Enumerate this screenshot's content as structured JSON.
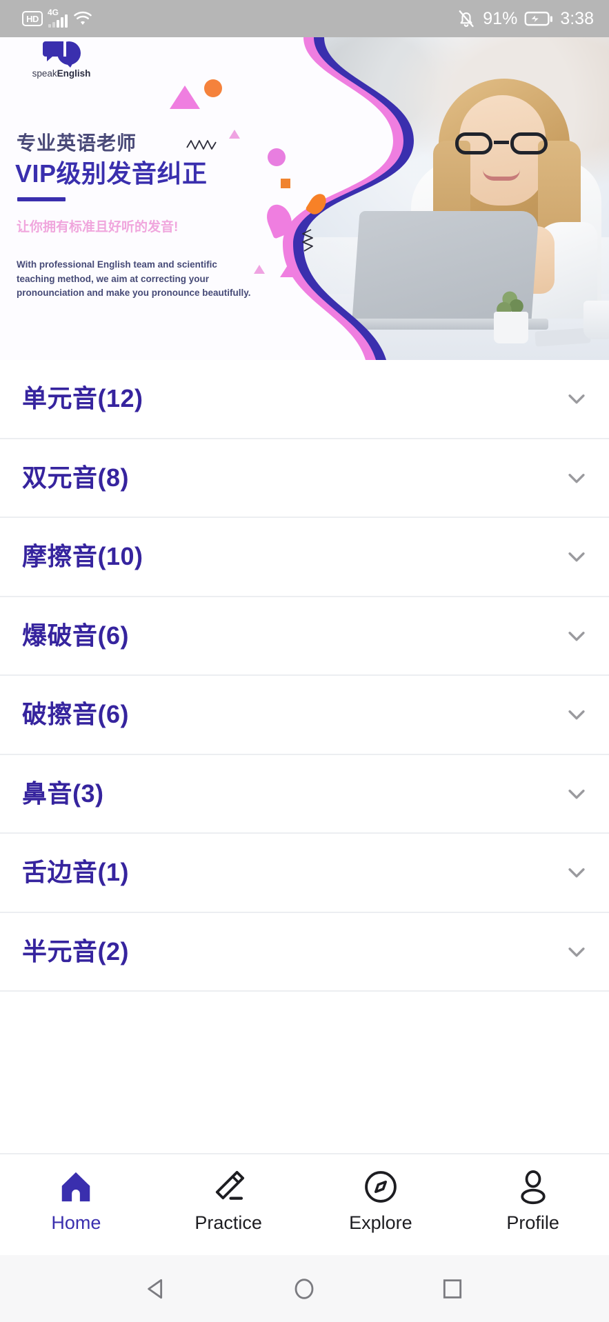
{
  "status_bar": {
    "hd_label": "HD",
    "network_label": "4G",
    "signal_icon": "signal-bars-icon",
    "wifi_icon": "wifi-icon",
    "mute_icon": "bell-muted-icon",
    "battery_percent": "91%",
    "battery_icon": "battery-charging-icon",
    "clock": "3:38",
    "background_color": "#b6b6b6",
    "foreground_color": "#ffffff"
  },
  "banner": {
    "logo_text_light": "speak",
    "logo_text_bold": "English",
    "logo_icon": "speech-bubbles-icon",
    "title_line1": "专业英语老师",
    "title_line2": "VIP级别发音纠正",
    "subtitle": "让你拥有标准且好听的发音!",
    "description": "With professional English team and scientific teaching method, we aim at correcting your pronounciation and make you pronounce beautifully.",
    "colors": {
      "title1": "#4a4a78",
      "title2": "#3a2fae",
      "subtitle": "#f0a6dd",
      "description": "#464a77",
      "wave_outer": "#ef7ee0",
      "wave_inner": "#3a2fae"
    }
  },
  "phoneme_list": {
    "chevron_icon": "chevron-down-icon",
    "items": [
      {
        "label": "单元音(12)"
      },
      {
        "label": "双元音(8)"
      },
      {
        "label": "摩擦音(10)"
      },
      {
        "label": "爆破音(6)"
      },
      {
        "label": "破擦音(6)"
      },
      {
        "label": "鼻音(3)"
      },
      {
        "label": "舌边音(1)"
      },
      {
        "label": "半元音(2)"
      }
    ]
  },
  "tabbar": {
    "active_color": "#3a2fae",
    "inactive_color": "#1d1d21",
    "tabs": [
      {
        "label": "Home",
        "icon": "home-icon",
        "active": true
      },
      {
        "label": "Practice",
        "icon": "pencil-icon",
        "active": false
      },
      {
        "label": "Explore",
        "icon": "compass-icon",
        "active": false
      },
      {
        "label": "Profile",
        "icon": "person-icon",
        "active": false
      }
    ]
  },
  "android_nav": {
    "back_icon": "back-triangle-icon",
    "home_icon": "home-circle-icon",
    "recents_icon": "recents-square-icon"
  }
}
